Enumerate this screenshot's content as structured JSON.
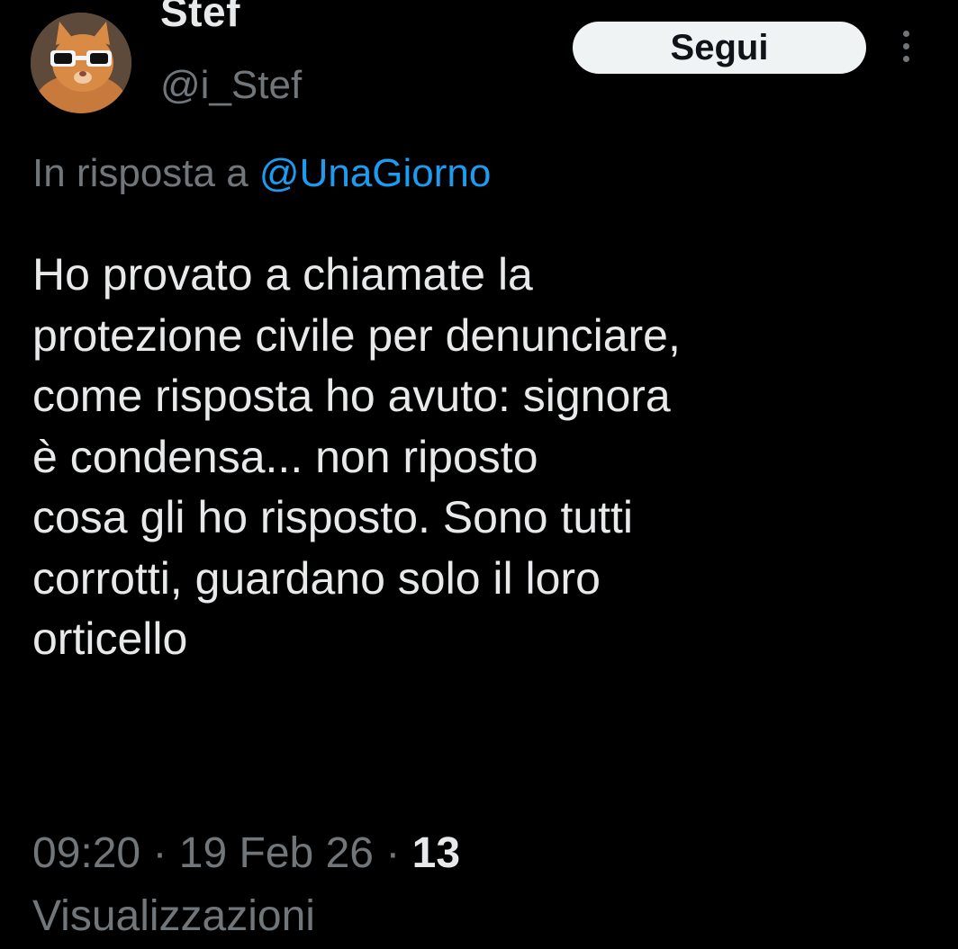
{
  "user": {
    "display_name": "Stef",
    "handle": "@i_Stef",
    "avatar": "cat-with-sunglasses-avatar"
  },
  "header": {
    "follow_label": "Segui",
    "more_icon": "more-vertical-icon"
  },
  "reply": {
    "prefix": "In risposta a",
    "mention": "@UnaGiorno"
  },
  "tweet": {
    "lines": [
      "Ho provato a chiamate la",
      "protezione civile per denunciare,",
      "come risposta ho avuto: signora",
      "è condensa... non riposto",
      "cosa gli ho risposto. Sono tutti",
      "corrotti, guardano solo il loro",
      "orticello"
    ]
  },
  "meta": {
    "time": "09:20",
    "separator": "·",
    "date": "19 Feb 26",
    "views_count": "13",
    "views_label": "Visualizzazioni"
  },
  "colors": {
    "background": "#000000",
    "text": "#e7e9ea",
    "secondary": "#71767b",
    "link": "#1d9bf0",
    "button_bg": "#eff3f4"
  }
}
